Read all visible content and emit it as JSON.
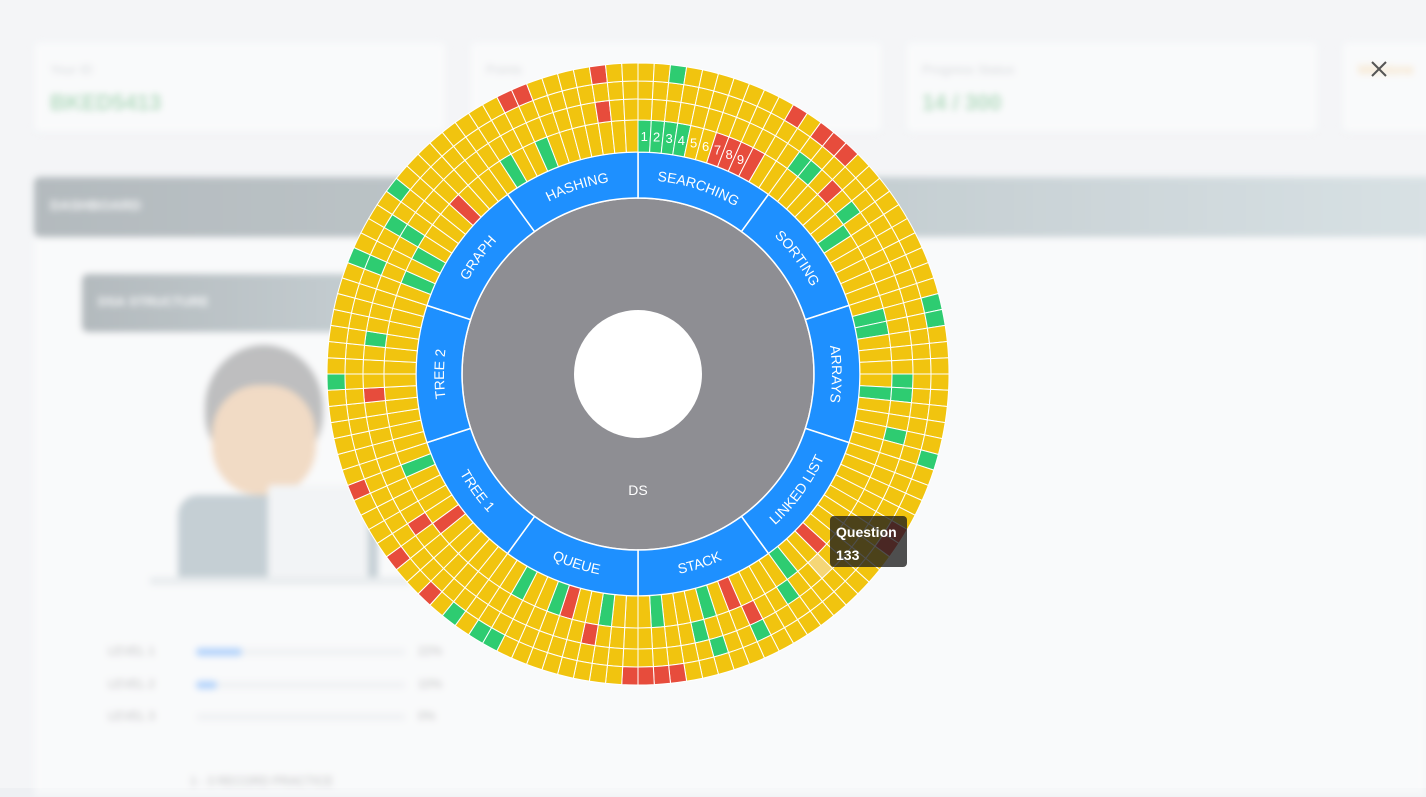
{
  "background": {
    "cards": [
      {
        "label": "Your ID",
        "value": "BKED5413"
      },
      {
        "label": "Points",
        "value": ""
      },
      {
        "label": "Progress Status",
        "value": "14 / 300"
      },
      {
        "label": "Milestone",
        "value": ""
      }
    ],
    "banner_title": "DASHBOARD",
    "sub_banner_title": "DSA STRUCTURE",
    "progress_rows": [
      {
        "label": "LEVEL 1",
        "value": "22%",
        "fraction": 0.22
      },
      {
        "label": "LEVEL 2",
        "value": "10%",
        "fraction": 0.1
      },
      {
        "label": "LEVEL 3",
        "value": "0%",
        "fraction": 0.0
      }
    ],
    "footer_text": "1 - 3 RECORD PRACTICE"
  },
  "chart": {
    "center_label": "DS",
    "categories": [
      "SEARCHING",
      "SORTING",
      "ARRAYS",
      "LINKED LIST",
      "STACK",
      "QUEUE",
      "TREE 1",
      "TREE 2",
      "GRAPH",
      "HASHING"
    ],
    "numbered_labels": [
      "1",
      "2",
      "3",
      "4",
      "5",
      "6",
      "7",
      "8",
      "9"
    ],
    "colors": {
      "solved": "#2ecc71",
      "attempted": "#f1c40f",
      "unsolved": "#e74c3c",
      "category": "#1e90ff",
      "center": "#8e8e93",
      "hover": "#f5d676"
    }
  },
  "tooltip": {
    "line1": "Question",
    "line2": "133"
  },
  "close_icon": "close-icon"
}
